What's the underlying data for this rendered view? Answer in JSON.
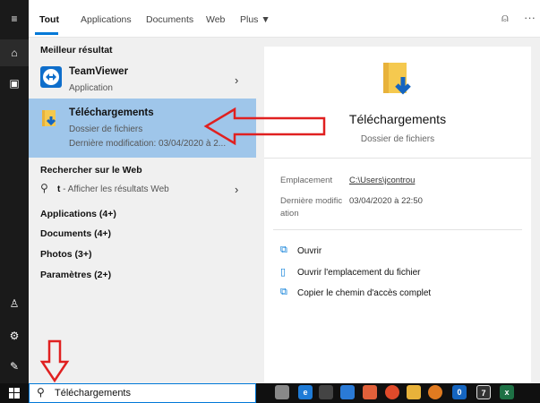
{
  "tabs": [
    "Tout",
    "Applications",
    "Documents",
    "Web",
    "Plus ▼"
  ],
  "best_match": {
    "header": "Meilleur résultat",
    "items": [
      {
        "name": "TeamViewer",
        "sub": "Application"
      },
      {
        "name": "Téléchargements",
        "sub": "Dossier de fichiers",
        "sub2": "Dernière modification: 03/04/2020 à 2..."
      }
    ]
  },
  "web": {
    "header": "Rechercher sur le Web",
    "query": "t",
    "query_suffix": " - Afficher les résultats Web"
  },
  "categories": [
    "Applications (4+)",
    "Documents (4+)",
    "Photos (3+)",
    "Paramètres (2+)"
  ],
  "preview": {
    "title": "Téléchargements",
    "subtitle": "Dossier de fichiers",
    "location_label": "Emplacement",
    "location_value": "C:\\Users\\jcontrou",
    "modified_label_1": "Dernière modific",
    "modified_label_2": "ation",
    "modified_value": "03/04/2020 à 22:50",
    "actions": [
      "Ouvrir",
      "Ouvrir l'emplacement du fichier",
      "Copier le chemin d'accès complet"
    ]
  },
  "search": {
    "value": "Téléchargements"
  },
  "taskbar_icons": [
    "0",
    "7",
    "x"
  ],
  "colors": {
    "accent": "#0078d7",
    "highlight": "#9fc6ea",
    "arrow": "#e02020"
  }
}
